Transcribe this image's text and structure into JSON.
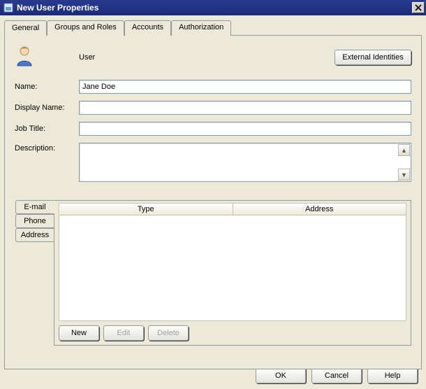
{
  "window": {
    "title": "New User Properties"
  },
  "tabs": [
    {
      "label": "General"
    },
    {
      "label": "Groups and Roles"
    },
    {
      "label": "Accounts"
    },
    {
      "label": "Authorization"
    }
  ],
  "top": {
    "user_type_label": "User",
    "external_identities_btn": "External Identities"
  },
  "fields": {
    "name_label": "Name:",
    "name_value": "Jane Doe",
    "display_name_label": "Display Name:",
    "display_name_value": "",
    "job_title_label": "Job Title:",
    "job_title_value": "",
    "description_label": "Description:",
    "description_value": ""
  },
  "contact_tabs": [
    {
      "label": "E-mail"
    },
    {
      "label": "Phone"
    },
    {
      "label": "Address"
    }
  ],
  "grid": {
    "columns": [
      "Type",
      "Address"
    ],
    "rows": []
  },
  "list_buttons": {
    "new": "New",
    "edit": "Edit",
    "delete": "Delete"
  },
  "dialog_buttons": {
    "ok": "OK",
    "cancel": "Cancel",
    "help": "Help"
  }
}
